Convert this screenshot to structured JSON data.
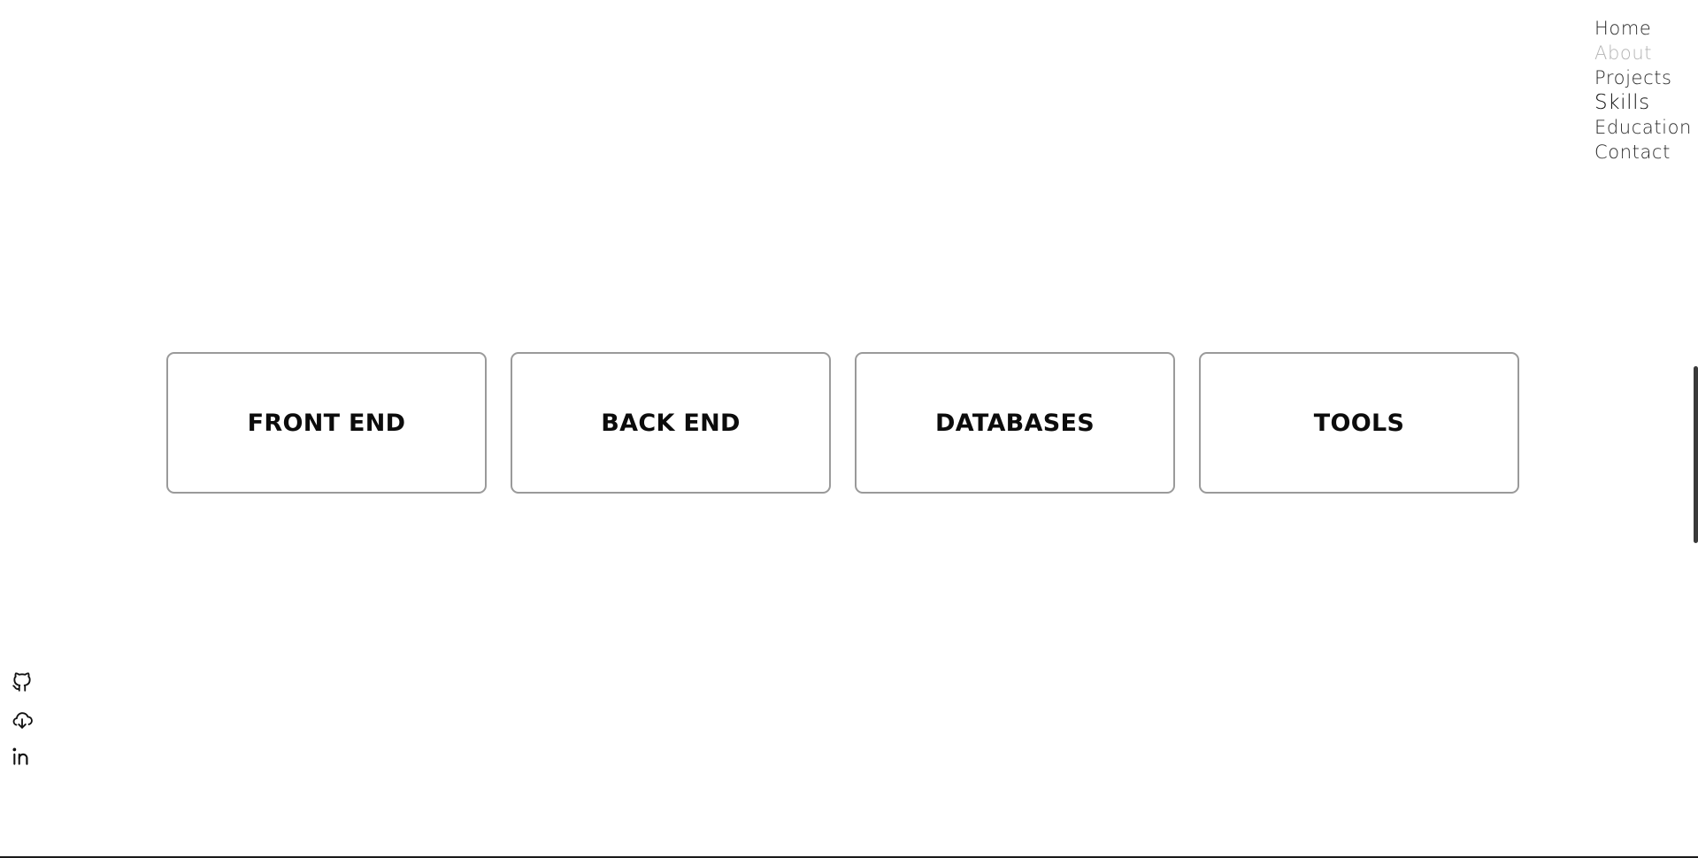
{
  "nav": {
    "items": [
      {
        "label": "Home"
      },
      {
        "label": "About"
      },
      {
        "label": "Projects"
      },
      {
        "label": "Skills"
      },
      {
        "label": "Education"
      },
      {
        "label": "Contact"
      }
    ]
  },
  "skills": {
    "cards": [
      {
        "label": "FRONT END"
      },
      {
        "label": "BACK END"
      },
      {
        "label": "DATABASES"
      },
      {
        "label": "TOOLS"
      }
    ]
  },
  "social": {
    "icons": [
      "github-icon",
      "cloud-download-icon",
      "linkedin-icon"
    ]
  },
  "colors": {
    "text": "#111111",
    "muted": "#b4b4b4",
    "card_border": "#9a9a9a",
    "background": "#ffffff"
  }
}
